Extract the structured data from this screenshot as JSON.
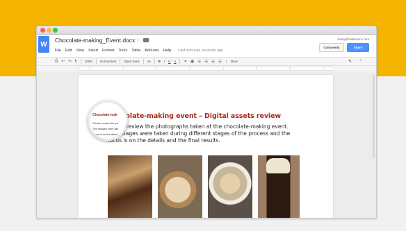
{
  "window": {
    "doc_title": "Chocolate-making_Event.docx",
    "logo_letter": "W",
    "user_email": "casey@solarmore.com",
    "comments_label": "Comments",
    "share_label": "Share"
  },
  "menubar": {
    "items": [
      "File",
      "Edit",
      "View",
      "Insert",
      "Format",
      "Tools",
      "Table",
      "Add-ons",
      "Help"
    ],
    "last_edit": "Last edit was seconds ago"
  },
  "toolbar": {
    "zoom": "100%",
    "style": "Normal text",
    "font": "Open Sans",
    "font_size": "16",
    "bold": "B",
    "italic": "I",
    "underline": "U",
    "text_color": "A",
    "more": "More"
  },
  "ruler": {
    "ticks": [
      "1",
      "1",
      "2",
      "3",
      "4",
      "5",
      "6",
      "7"
    ]
  },
  "document": {
    "heading": "Chocolate-making event – Digital assets review",
    "para_line1": "Please review the photographs taken at the chocolate-making event.",
    "para_line2": "The images were taken during different stages of the  process and the",
    "para_line3": "focus is on the details and the final results."
  },
  "magnifier": {
    "title": "Chocolate-mak",
    "line1": "Please review the ph",
    "line2": "The images were tak",
    "line3": "focus is on the detai"
  },
  "photos": [
    {
      "name": "chocolate-tart"
    },
    {
      "name": "pastry-on-plate"
    },
    {
      "name": "cappuccino"
    },
    {
      "name": "iced-chocolate-drink"
    }
  ],
  "colors": {
    "brand_band": "#f4b400",
    "heading": "#a52a1a",
    "share_button": "#4d90fe",
    "docs_logo": "#4285f4"
  }
}
